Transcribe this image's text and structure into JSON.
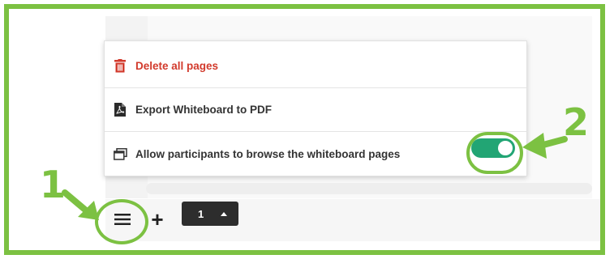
{
  "menu": {
    "items": [
      {
        "label": "Delete all pages",
        "icon": "trash-icon"
      },
      {
        "label": "Export Whiteboard to PDF",
        "icon": "pdf-file-icon"
      },
      {
        "label": "Allow participants to browse the whiteboard pages",
        "icon": "window-stack-icon"
      }
    ],
    "browse_toggle": {
      "on": true
    }
  },
  "toolbar": {
    "menu_icon": "hamburger-menu-icon",
    "add_page_label": "+",
    "page_number": "1"
  },
  "callouts": {
    "one": "1",
    "two": "2"
  },
  "colors": {
    "accent_green": "#7cc142",
    "toggle_on": "#22a574",
    "danger": "#d23a2c",
    "page_select_bg": "#2d2d2d"
  }
}
